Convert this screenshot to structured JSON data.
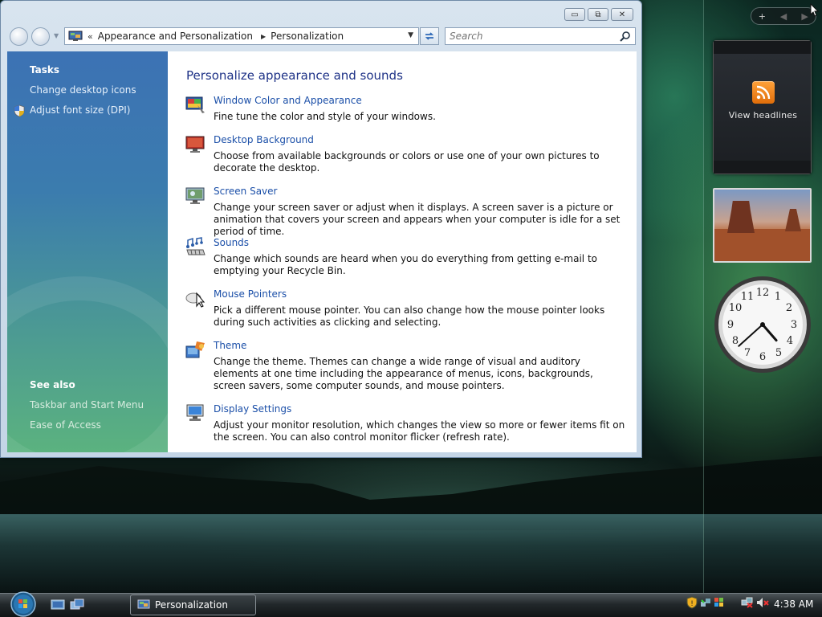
{
  "window": {
    "breadcrumb": {
      "chevron": "«",
      "parent": "Appearance and Personalization",
      "separator": "▶",
      "current": "Personalization"
    },
    "search": {
      "placeholder": "Search"
    },
    "caption": {
      "minimize": "▭",
      "maximize": "⧉",
      "close": "✕"
    }
  },
  "left_pane": {
    "tasks_heading": "Tasks",
    "tasks": [
      {
        "label": "Change desktop icons"
      },
      {
        "label": "Adjust font size (DPI)"
      }
    ],
    "see_also_heading": "See also",
    "see_also": [
      {
        "label": "Taskbar and Start Menu"
      },
      {
        "label": "Ease of Access"
      }
    ]
  },
  "content": {
    "title": "Personalize appearance and sounds",
    "items": [
      {
        "icon": "window-color-icon",
        "title": "Window Color and Appearance",
        "desc": "Fine tune the color and style of your windows."
      },
      {
        "icon": "desktop-background-icon",
        "title": "Desktop Background",
        "desc": "Choose from available backgrounds or colors or use one of your own pictures to decorate the desktop."
      },
      {
        "icon": "screen-saver-icon",
        "title": "Screen Saver",
        "desc": "Change your screen saver or adjust when it displays. A screen saver is a picture or animation that covers your screen and appears when your computer is idle for a set period of time."
      },
      {
        "icon": "sounds-icon",
        "title": "Sounds",
        "desc": "Change which sounds are heard when you do everything from getting e-mail to emptying your Recycle Bin."
      },
      {
        "icon": "mouse-pointers-icon",
        "title": "Mouse Pointers",
        "desc": "Pick a different mouse pointer. You can also change how the mouse pointer looks during such activities as clicking and selecting."
      },
      {
        "icon": "theme-icon",
        "title": "Theme",
        "desc": "Change the theme. Themes can change a wide range of visual and auditory elements at one time including the appearance of menus, icons, backgrounds, screen savers, some computer sounds, and mouse pointers."
      },
      {
        "icon": "display-settings-icon",
        "title": "Display Settings",
        "desc": "Adjust your monitor resolution, which changes the view so more or fewer items fit on the screen. You can also control monitor flicker (refresh rate)."
      }
    ]
  },
  "sidebar": {
    "controls": {
      "add": "+",
      "prev": "◀",
      "next": "▶"
    },
    "feed_label": "View headlines",
    "clock": {
      "hour": 4,
      "minute": 38
    }
  },
  "taskbar": {
    "task_label": "Personalization",
    "clock": "4:38 AM"
  },
  "colors": {
    "link": "#1b4fa8",
    "title": "#1e3287",
    "pane_top": "#3c72b4",
    "pane_bottom": "#5bb27f"
  }
}
